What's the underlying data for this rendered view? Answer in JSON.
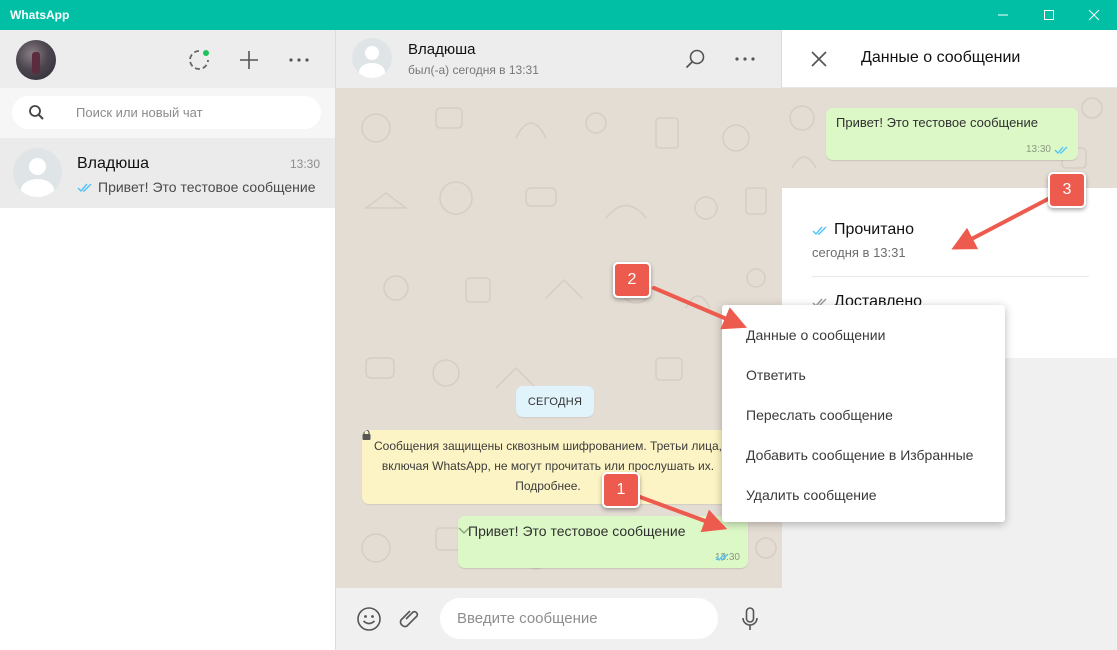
{
  "window": {
    "title": "WhatsApp",
    "accent": "#00bfa5"
  },
  "left_panel": {
    "search_placeholder": "Поиск или новый чат",
    "chats": [
      {
        "name": "Владюша",
        "time": "13:30",
        "preview": "Привет! Это тестовое сообщение",
        "status_icon": "double-check-icon"
      }
    ],
    "header_icons": [
      "status-icon",
      "new-chat-icon",
      "menu-icon"
    ]
  },
  "conversation": {
    "contact_name": "Владюша",
    "contact_status": "был(-а) сегодня в 13:31",
    "date_chip": "СЕГОДНЯ",
    "encryption_notice": "Сообщения защищены сквозным шифрованием. Третьи лица, включая WhatsApp, не могут прочитать или прослушать их. Подробнее.",
    "message": {
      "text": "Привет! Это тестовое сообщение",
      "time": "13:30"
    },
    "input_placeholder": "Введите сообщение",
    "outgoing_bubble_color": "#dcf8c6"
  },
  "context_menu": {
    "items": [
      "Данные о сообщении",
      "Ответить",
      "Переслать сообщение",
      "Добавить сообщение в Избранные",
      "Удалить сообщение"
    ]
  },
  "details_panel": {
    "title": "Данные о сообщении",
    "message_text": "Привет! Это тестовое сообщение",
    "message_time": "13:30",
    "read_label": "Прочитано",
    "read_time": "сегодня в 13:31",
    "delivered_label": "Доставлено",
    "read_tick_color": "#4fc3f7"
  },
  "annotations": {
    "badges": [
      "1",
      "2",
      "3"
    ],
    "color": "#ec5b4e"
  }
}
